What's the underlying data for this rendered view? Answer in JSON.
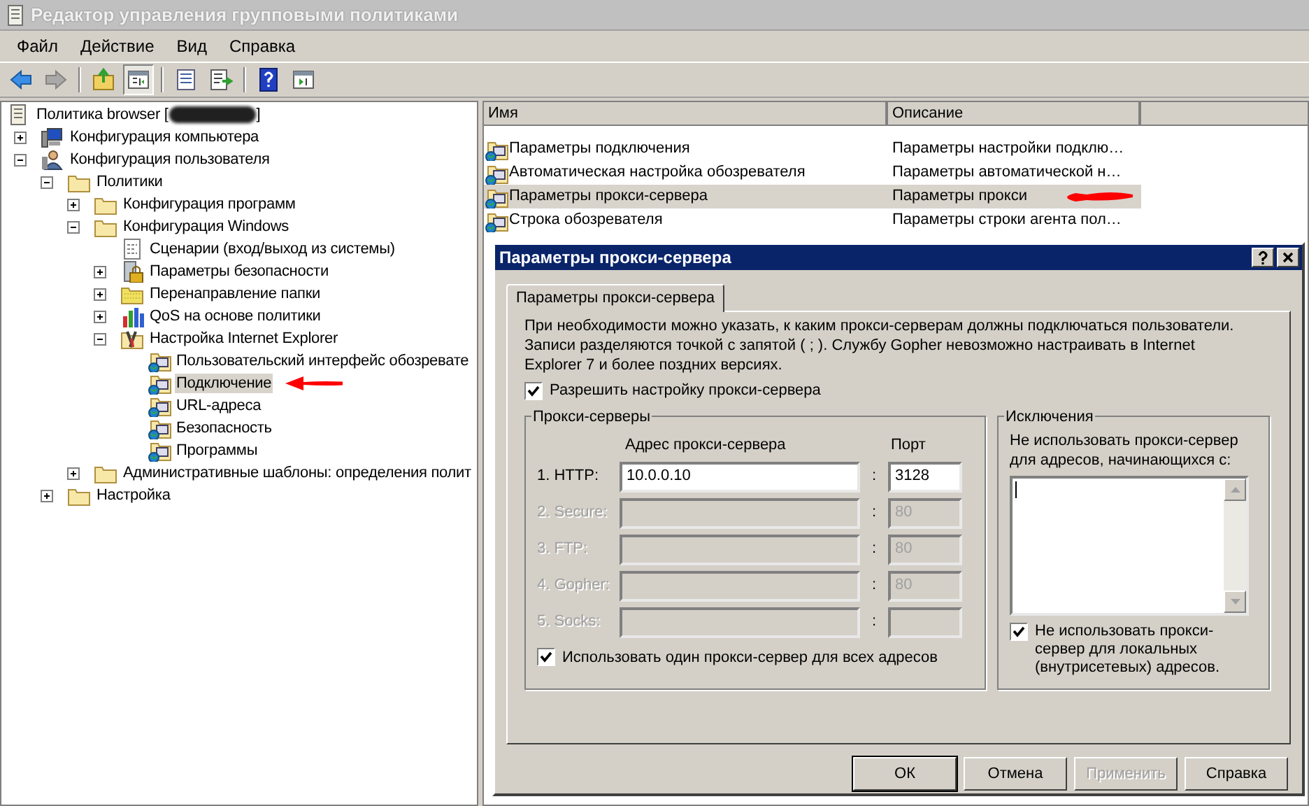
{
  "window": {
    "title": "Редактор управления групповыми политиками"
  },
  "menu": [
    "Файл",
    "Действие",
    "Вид",
    "Справка"
  ],
  "toolbar": [
    {
      "kind": "back",
      "disabled": false,
      "selected": false
    },
    {
      "kind": "forward",
      "disabled": true,
      "selected": false
    },
    {
      "kind": "sep"
    },
    {
      "kind": "up",
      "disabled": false,
      "selected": false
    },
    {
      "kind": "tree",
      "disabled": false,
      "selected": true
    },
    {
      "kind": "sep"
    },
    {
      "kind": "props",
      "disabled": false,
      "selected": false
    },
    {
      "kind": "export",
      "disabled": false,
      "selected": false
    },
    {
      "kind": "sep"
    },
    {
      "kind": "help",
      "disabled": false,
      "selected": false
    },
    {
      "kind": "view",
      "disabled": false,
      "selected": false
    }
  ],
  "tree": [
    {
      "kind": "policy",
      "label": "Политика browser [",
      "label_end": "]",
      "redacted": true,
      "selected": false,
      "children": [
        {
          "kind": "computer",
          "label": "Конфигурация компьютера",
          "expanded": false,
          "selected": false
        },
        {
          "kind": "user",
          "label": "Конфигурация пользователя",
          "expanded": true,
          "selected": false,
          "children": [
            {
              "kind": "folder",
              "label": "Политики",
              "expanded": true,
              "selected": false,
              "children": [
                {
                  "kind": "folder",
                  "label": "Конфигурация программ",
                  "expanded": false,
                  "selected": false
                },
                {
                  "kind": "folder",
                  "label": "Конфигурация Windows",
                  "expanded": true,
                  "selected": false,
                  "children": [
                    {
                      "kind": "script",
                      "label": "Сценарии (вход/выход из системы)",
                      "selected": false
                    },
                    {
                      "kind": "security",
                      "label": "Параметры безопасности",
                      "expanded": false,
                      "selected": false
                    },
                    {
                      "kind": "redirect",
                      "label": "Перенаправление папки",
                      "expanded": false,
                      "selected": false
                    },
                    {
                      "kind": "qos",
                      "label": "QoS на основе политики",
                      "expanded": false,
                      "selected": false
                    },
                    {
                      "kind": "tools",
                      "label": "Настройка Internet Explorer",
                      "expanded": true,
                      "selected": false,
                      "children": [
                        {
                          "kind": "ie",
                          "label": "Пользовательский интерфейс обозревате",
                          "selected": false
                        },
                        {
                          "kind": "ie",
                          "label": "Подключение",
                          "selected": true,
                          "arrow": true
                        },
                        {
                          "kind": "ie",
                          "label": "URL-адреса",
                          "selected": false
                        },
                        {
                          "kind": "ie",
                          "label": "Безопасность",
                          "selected": false
                        },
                        {
                          "kind": "ie",
                          "label": "Программы",
                          "selected": false
                        }
                      ]
                    }
                  ]
                },
                {
                  "kind": "folder",
                  "label": "Административные шаблоны: определения полит",
                  "expanded": false,
                  "selected": false
                }
              ]
            },
            {
              "kind": "folder",
              "label": "Настройка",
              "expanded": false,
              "selected": false
            }
          ]
        }
      ]
    }
  ],
  "list": {
    "columns": [
      "Имя",
      "Описание"
    ],
    "rows": [
      {
        "name": "Параметры подключения",
        "description": "Параметры настройки подклю…",
        "selected": false
      },
      {
        "name": "Автоматическая настройка обозревателя",
        "description": "Параметры автоматической н…",
        "selected": false
      },
      {
        "name": "Параметры прокси-сервера",
        "description": "Параметры прокси",
        "selected": true,
        "arrow": true
      },
      {
        "name": "Строка обозревателя",
        "description": "Параметры строки агента пол…",
        "selected": false
      }
    ]
  },
  "dialog": {
    "title": "Параметры прокси-сервера",
    "tab": "Параметры прокси-сервера",
    "intro": "При необходимости можно указать, к каким прокси-серверам должны подключаться пользователи. Записи разделяются точкой с запятой ( ; ). Службу Gopher невозможно настраивать в Internet Explorer 7 и более поздних версиях.",
    "enable": {
      "label": "Разрешить настройку прокси-сервера",
      "checked": true
    },
    "servers": {
      "title": "Прокси-серверы",
      "address_header": "Адрес прокси-сервера",
      "port_header": "Порт",
      "separator": ":",
      "rows": [
        {
          "label": "1. HTTP:",
          "address": "10.0.0.10",
          "port": "3128",
          "disabled": false
        },
        {
          "label": "2. Secure:",
          "port": "80",
          "disabled": true
        },
        {
          "label": "3. FTP:",
          "port": "80",
          "disabled": true
        },
        {
          "label": "4. Gopher:",
          "port": "80",
          "disabled": true
        },
        {
          "label": "5. Socks:",
          "disabled": true
        }
      ],
      "same": {
        "label": "Использовать один прокси-сервер для всех адресов",
        "checked": true
      }
    },
    "exceptions": {
      "title": "Исключения",
      "hint": "Не использовать прокси-сервер для адресов, начинающихся с:",
      "local": {
        "label": "Не использовать прокси-сервер для локальных (внутрисетевых) адресов.",
        "checked": true
      }
    },
    "buttons": [
      {
        "label": "ОК",
        "default": true,
        "disabled": false
      },
      {
        "label": "Отмена",
        "default": false,
        "disabled": false
      },
      {
        "label": "Применить",
        "default": false,
        "disabled": true
      },
      {
        "label": "Справка",
        "default": false,
        "disabled": false
      }
    ]
  }
}
